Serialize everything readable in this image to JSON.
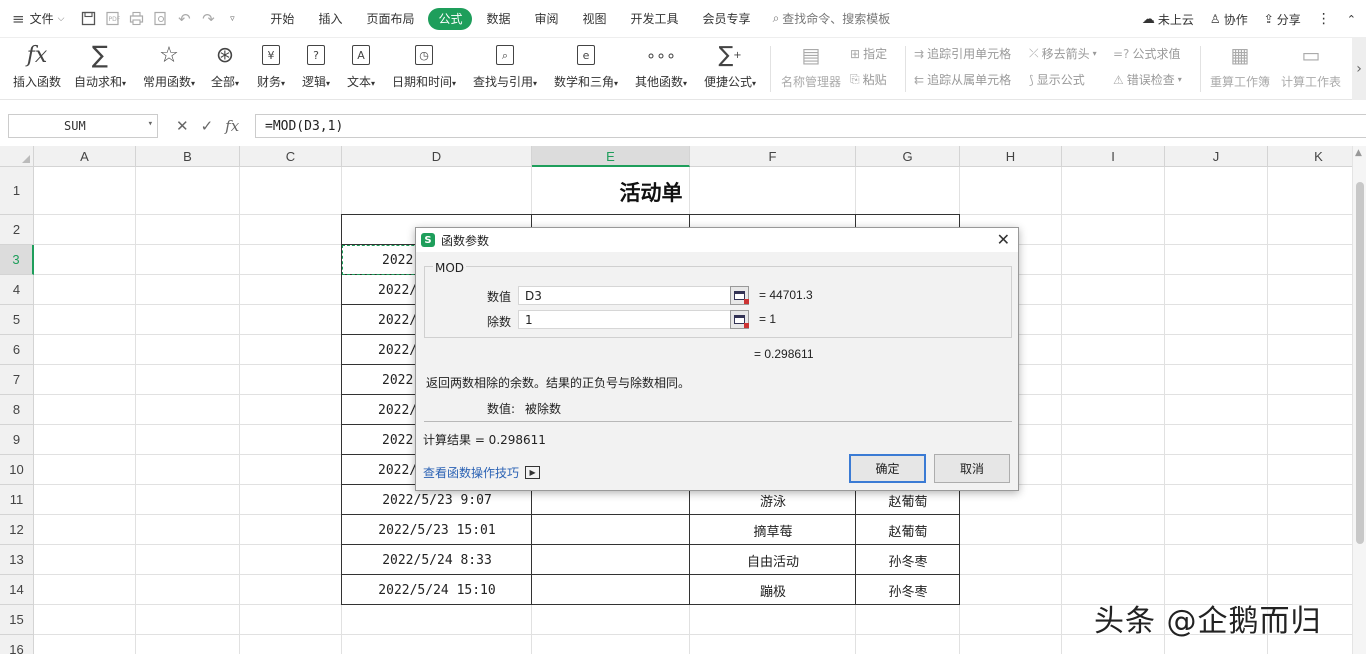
{
  "menubar": {
    "file_label": "文件",
    "tabs": [
      "开始",
      "插入",
      "页面布局",
      "公式",
      "数据",
      "审阅",
      "视图",
      "开发工具",
      "会员专享"
    ],
    "active_tab": "公式",
    "search_label": "查找命令、搜索模板",
    "right": {
      "cloud": "未上云",
      "collab": "协作",
      "share": "分享"
    }
  },
  "ribbon": {
    "insert_fn": "插入函数",
    "autosum": "自动求和",
    "common_fn": "常用函数",
    "all": "全部",
    "finance": "财务",
    "logic": "逻辑",
    "text": "文本",
    "datetime": "日期和时间",
    "lookup": "查找与引用",
    "math": "数学和三角",
    "other_fn": "其他函数",
    "quick_formula": "便捷公式",
    "name_mgr": "名称管理器",
    "specify": "指定",
    "paste": "粘贴",
    "trace_prec": "追踪引用单元格",
    "trace_dep": "追踪从属单元格",
    "remove_arrows": "移去箭头",
    "show_formula": "显示公式",
    "eval_formula": "公式求值",
    "error_check": "错误检查",
    "recalc_book": "重算工作簿",
    "calc_sheet": "计算工作表"
  },
  "formula_bar": {
    "name_box": "SUM",
    "formula": "=MOD(D3,1)"
  },
  "sheet": {
    "columns": [
      "A",
      "B",
      "C",
      "D",
      "E",
      "F",
      "G",
      "H",
      "I",
      "J",
      "K"
    ],
    "selected_column": "E",
    "rows": [
      "1",
      "2",
      "3",
      "4",
      "5",
      "6",
      "7",
      "8",
      "9",
      "10",
      "11",
      "12",
      "13",
      "14",
      "15",
      "16"
    ],
    "selected_row": "3",
    "title": "活动单",
    "d_partial": [
      "2022",
      "2022/",
      "2022/",
      "2022/",
      "2022",
      "2022/",
      "2022",
      "2022/"
    ],
    "visible_rows": [
      {
        "d": "2022/5/23 9:07",
        "f": "游泳",
        "g": "赵葡萄"
      },
      {
        "d": "2022/5/23 15:01",
        "f": "摘草莓",
        "g": "赵葡萄"
      },
      {
        "d": "2022/5/24 8:33",
        "f": "自由活动",
        "g": "孙冬枣"
      },
      {
        "d": "2022/5/24 15:10",
        "f": "蹦极",
        "g": "孙冬枣"
      }
    ]
  },
  "dialog": {
    "title": "函数参数",
    "function_name": "MOD",
    "args": [
      {
        "label": "数值",
        "value": "D3",
        "result": "= 44701.3"
      },
      {
        "label": "除数",
        "value": "1",
        "result": "= 1"
      }
    ],
    "formula_result": "= 0.298611",
    "description": "返回两数相除的余数。结果的正负号与除数相同。",
    "arg_help_label": "数值:",
    "arg_help_text": "被除数",
    "calc_result": "计算结果 = 0.298611",
    "tips_link": "查看函数操作技巧",
    "ok": "确定",
    "cancel": "取消"
  },
  "watermark": "头条 @企鹅而归"
}
